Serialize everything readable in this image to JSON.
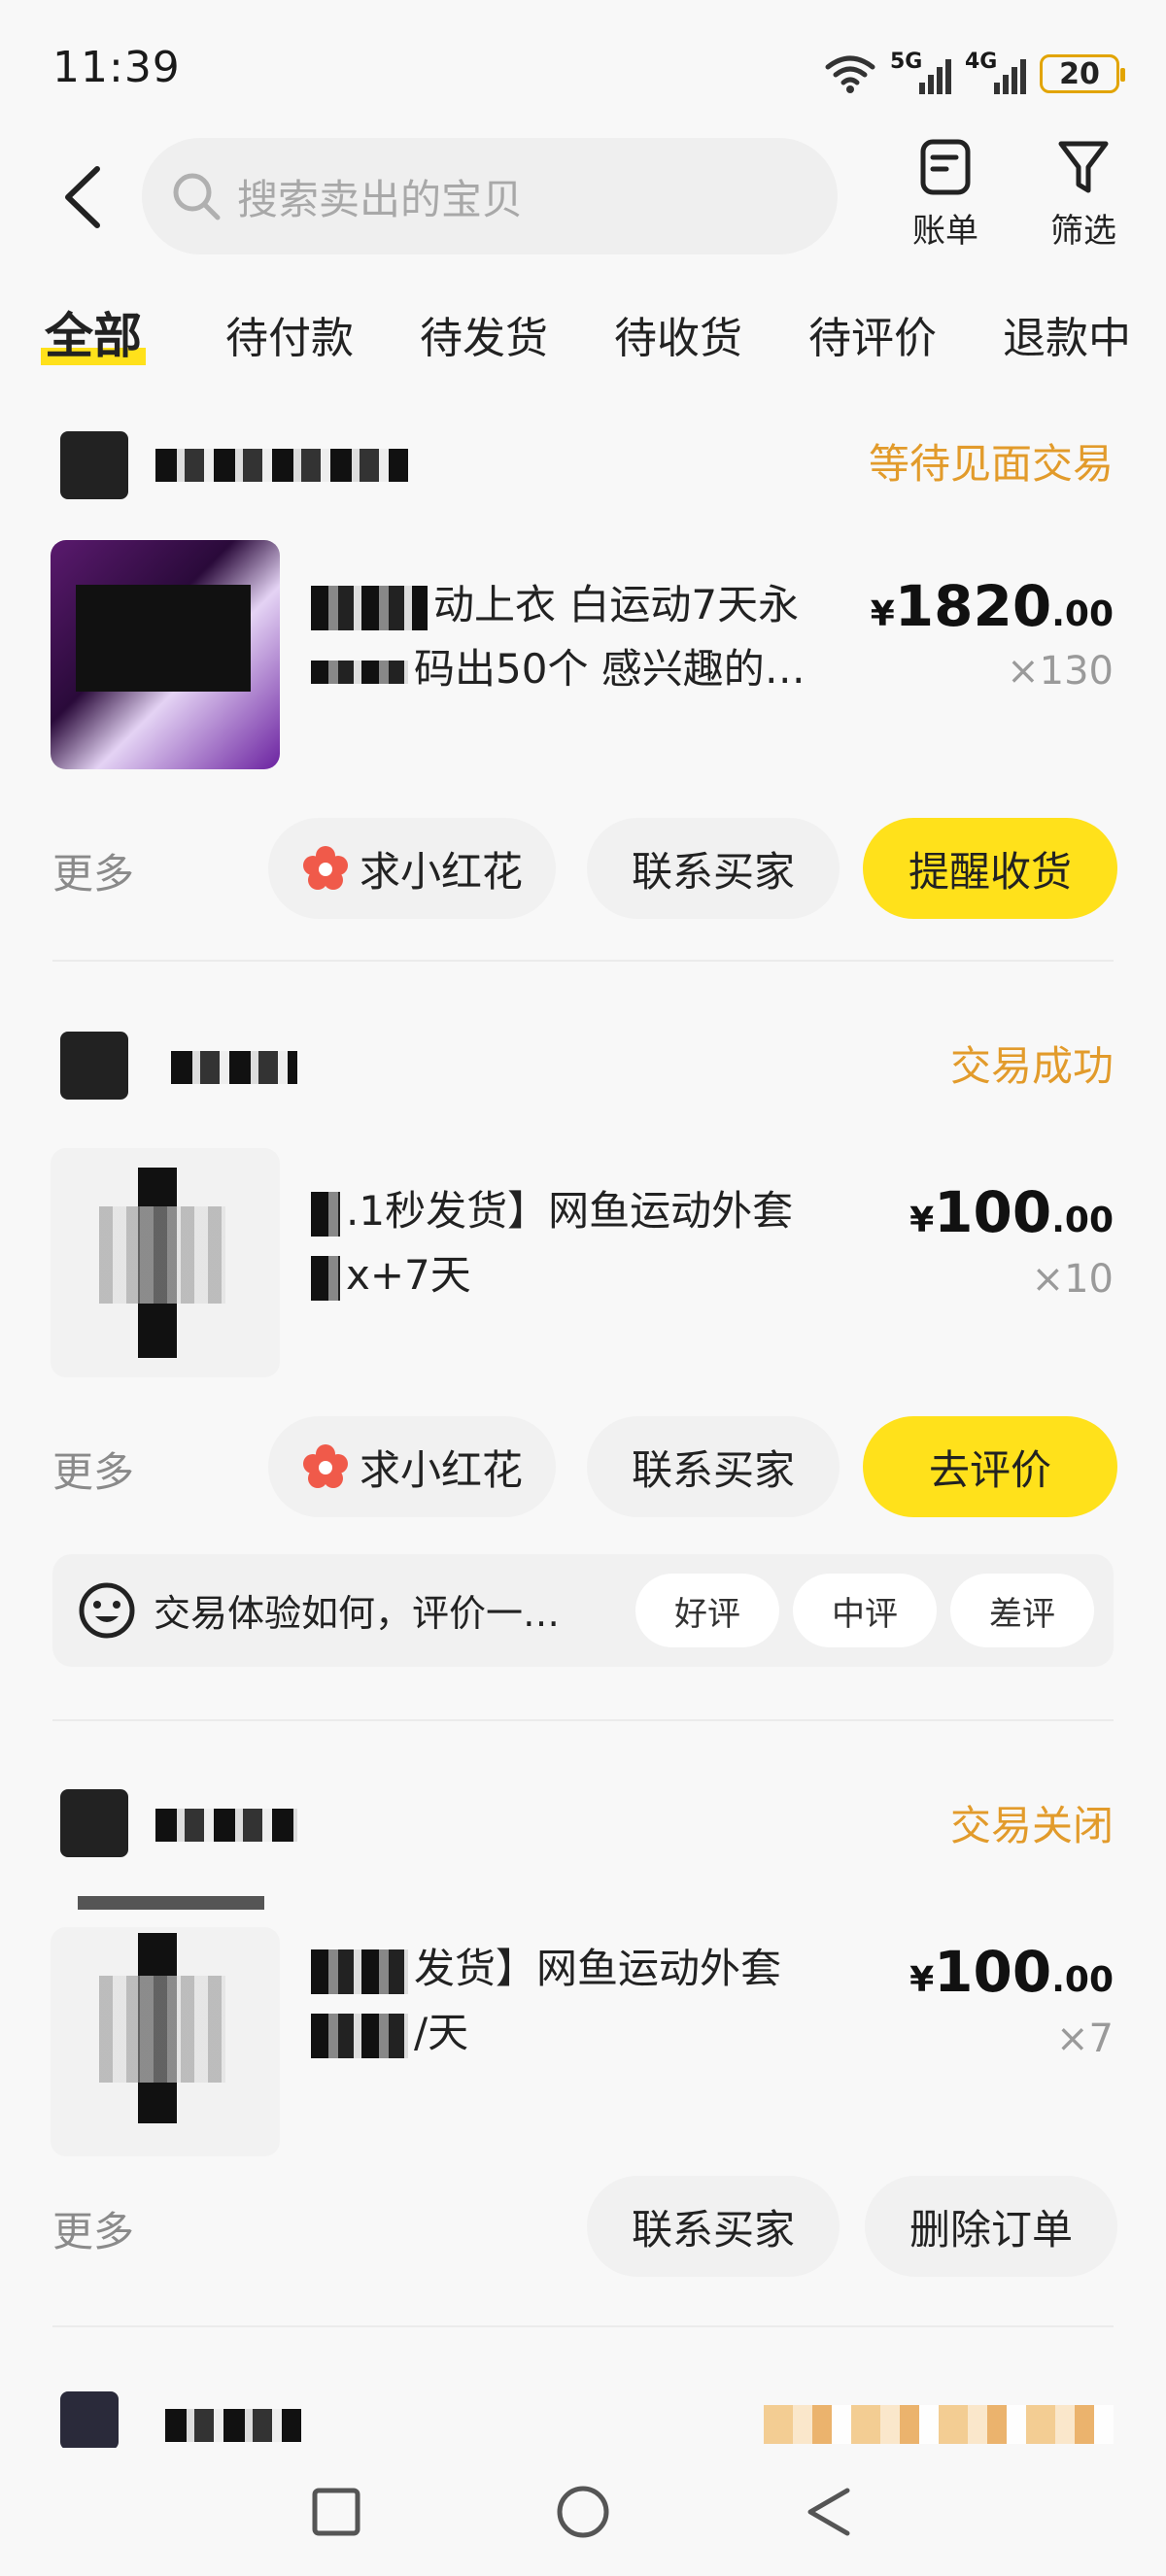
{
  "status_bar": {
    "time": "11:39",
    "net1": "5G",
    "net2": "4G",
    "battery": "20"
  },
  "search": {
    "placeholder": "搜索卖出的宝贝"
  },
  "header": {
    "bill_label": "账单",
    "filter_label": "筛选"
  },
  "tabs": [
    {
      "label": "全部",
      "active": true
    },
    {
      "label": "待付款"
    },
    {
      "label": "待发货"
    },
    {
      "label": "待收货"
    },
    {
      "label": "待评价"
    },
    {
      "label": "退款中"
    }
  ],
  "orders": [
    {
      "status": "等待见面交易",
      "title_line1": "动上衣 白运动7天永",
      "title_line2": "码出50个 感兴趣的…",
      "price_yen": "¥",
      "price_int": "1820",
      "price_dec": ".00",
      "quantity": "×130",
      "more": "更多",
      "actions": [
        "求小红花",
        "联系买家",
        "提醒收货"
      ]
    },
    {
      "status": "交易成功",
      "title_line1": ".1秒发货】网鱼运动外套",
      "title_line2": "x+7天",
      "price_yen": "¥",
      "price_int": "100",
      "price_dec": ".00",
      "quantity": "×10",
      "more": "更多",
      "actions": [
        "求小红花",
        "联系买家",
        "去评价"
      ],
      "review": {
        "question": "交易体验如何，评价一…",
        "good": "好评",
        "neutral": "中评",
        "bad": "差评"
      }
    },
    {
      "status": "交易关闭",
      "title_line1": "发货】网鱼运动外套",
      "title_line2": "/天",
      "price_yen": "¥",
      "price_int": "100",
      "price_dec": ".00",
      "quantity": "×7",
      "more": "更多",
      "actions": [
        "联系买家",
        "删除订单"
      ]
    }
  ],
  "colors": {
    "accent_yellow": "#ffe11b",
    "status_orange": "#e29b2b",
    "background": "#f8f8f8"
  }
}
